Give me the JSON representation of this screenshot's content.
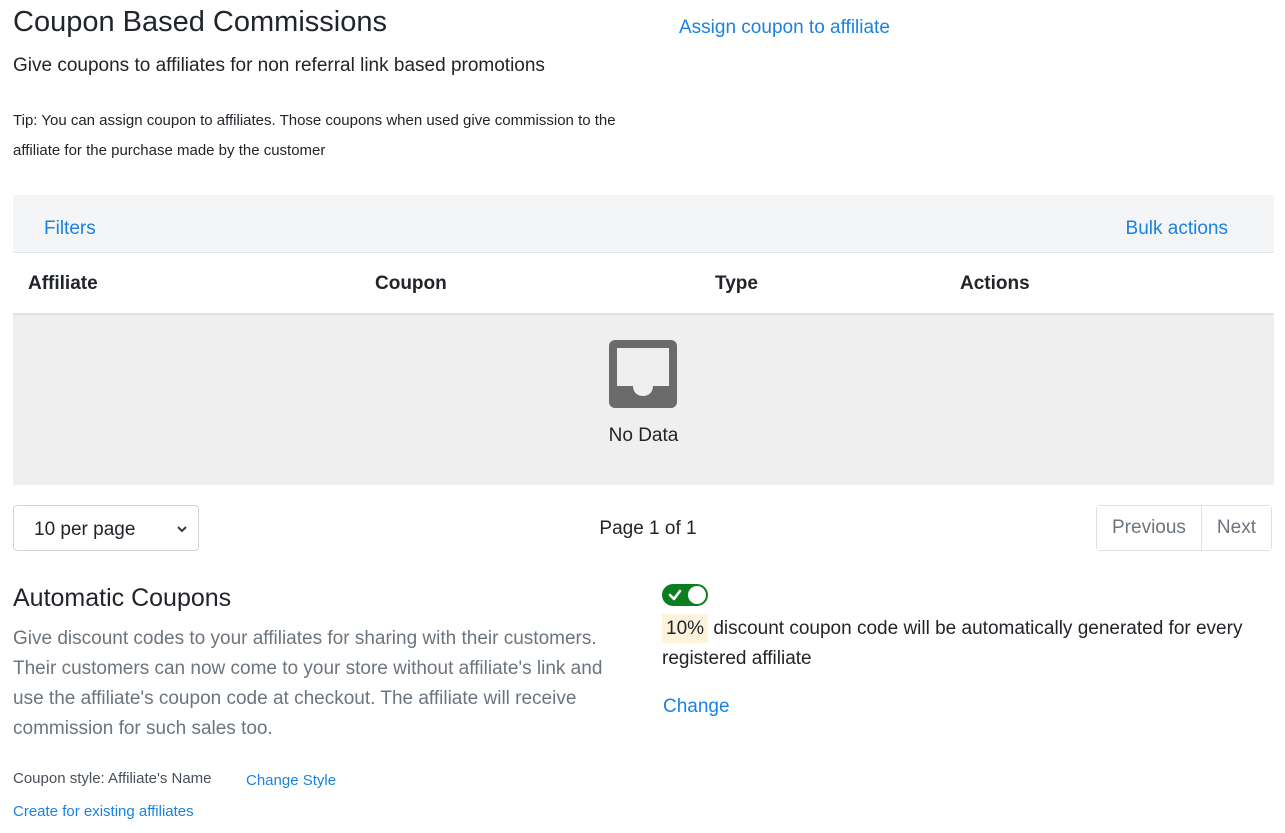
{
  "header": {
    "title": "Coupon Based Commissions",
    "subtitle": "Give coupons to affiliates for non referral link based promotions",
    "tip": "Tip: You can assign coupon to affiliates. Those coupons when used give commission to the affiliate for the purchase made by the customer",
    "assign_link": "Assign coupon to affiliate"
  },
  "toolbar": {
    "filters": "Filters",
    "bulk_actions": "Bulk actions"
  },
  "table": {
    "columns": [
      "Affiliate",
      "Coupon",
      "Type",
      "Actions"
    ],
    "rows": [],
    "empty_text": "No Data",
    "empty_icon": "inbox-icon"
  },
  "pagination": {
    "per_page_selected": "10 per page",
    "page_info": "Page 1 of 1",
    "previous": "Previous",
    "next": "Next"
  },
  "automatic_coupons": {
    "title": "Automatic Coupons",
    "description": "Give discount codes to your affiliates for sharing with their customers. Their customers can now come to your store without affiliate's link and use the affiliate's coupon code at checkout. The affiliate will receive commission for such sales too.",
    "coupon_style_label": "Coupon style: Affiliate's Name",
    "change_style": "Change Style",
    "create_existing": "Create for existing affiliates",
    "enabled": true,
    "discount_value": "10%",
    "discount_text": "discount coupon code will be automatically generated for every registered affiliate",
    "change_link": "Change"
  },
  "colors": {
    "link": "#1a82e2",
    "toggle_on": "#0a7f1f",
    "highlight": "#fdf3dc",
    "muted_text": "#6c757d"
  }
}
